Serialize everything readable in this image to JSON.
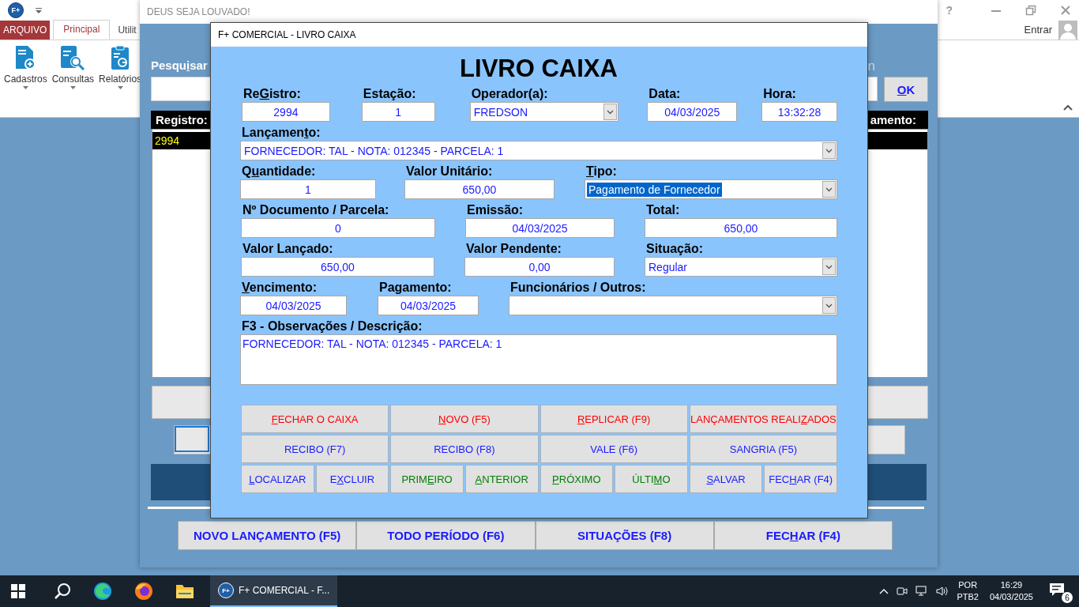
{
  "app": {
    "logo": "F+",
    "help": "?",
    "user": "Entrar",
    "tabs": [
      {
        "label": "ARQUIVO",
        "kind": "file",
        "selected": false
      },
      {
        "label": "Principal",
        "kind": "tab",
        "selected": true
      },
      {
        "label": "Utilit",
        "kind": "tab",
        "selected": false
      }
    ],
    "ribbon": [
      {
        "label": "Cadastros",
        "kind": "register"
      },
      {
        "label": "Consultas",
        "kind": "query"
      },
      {
        "label": "Relatórios",
        "kind": "report"
      }
    ]
  },
  "background_window": {
    "title": "DEUS SEJA LOUVADO!",
    "search_label": {
      "before": "Pesqu",
      "key": "i",
      "after": "sar"
    },
    "search_label_2": "n",
    "ok_button": {
      "key": "O",
      "after": "K"
    },
    "table": {
      "columns": [
        "Registro:",
        "amento:"
      ],
      "rows": [
        {
          "cells": [
            "2994"
          ],
          "selected": true
        }
      ]
    },
    "buttons": [
      {
        "label": "NOVO LANÇAMENTO (F5)"
      },
      {
        "label": "TODO PERÍODO (F6)"
      },
      {
        "label": "SITUAÇÕES (F8)"
      },
      {
        "label": {
          "before": "FEC",
          "key": "H",
          "after": "AR (F4)"
        }
      }
    ]
  },
  "dialog": {
    "title": "F+ COMERCIAL - LIVRO CAIXA",
    "heading": "LIVRO CAIXA",
    "rows": [
      [
        {
          "label": {
            "before": "Re",
            "key": "G",
            "after": "istro:"
          },
          "value": "2994",
          "kind": "input"
        },
        {
          "label": "Estação:",
          "value": "1",
          "kind": "input"
        },
        {
          "label": "Operador(a):",
          "value": "FREDSON",
          "kind": "combo"
        },
        {
          "label": "Data:",
          "value": "04/03/2025",
          "kind": "input"
        },
        {
          "label": "Hora:",
          "value": "13:32:28",
          "kind": "input"
        }
      ],
      [
        {
          "label": {
            "before": "Lançamen",
            "key": "t",
            "after": "o:"
          },
          "value": "FORNECEDOR: TAL - NOTA: 012345 - PARCELA: 1",
          "kind": "combo"
        }
      ],
      [
        {
          "label": {
            "before": "Q",
            "key": "u",
            "after": "antidade:"
          },
          "value": "1",
          "kind": "input"
        },
        {
          "label": "Valor Unitário:",
          "value": "650,00",
          "kind": "input"
        },
        {
          "label": {
            "key": "T",
            "after": "ipo:"
          },
          "value": "Pagamento de Fornecedor",
          "kind": "combo",
          "highlighted": true
        }
      ],
      [
        {
          "label": "Nº Documento / Parcela:",
          "value": "0",
          "kind": "input"
        },
        {
          "label": "Emissão:",
          "value": "04/03/2025",
          "kind": "input"
        },
        {
          "label": "Total:",
          "value": "650,00",
          "kind": "input"
        }
      ],
      [
        {
          "label": "Valor Lançado:",
          "value": "650,00",
          "kind": "input"
        },
        {
          "label": "Valor Pendente:",
          "value": "0,00",
          "kind": "input"
        },
        {
          "label": "Situação:",
          "value": "Regular",
          "kind": "combo"
        }
      ],
      [
        {
          "label": {
            "key": "V",
            "after": "encimento:"
          },
          "value": "04/03/2025",
          "kind": "input"
        },
        {
          "label": "Pagamento:",
          "value": "04/03/2025",
          "kind": "input"
        },
        {
          "label": "Funcionários / Outros:",
          "kind": "combo"
        }
      ]
    ],
    "notes": {
      "label": "F3 - Observações / Descrição:",
      "value": "FORNECEDOR: TAL - NOTA: 012345 - PARCELA: 1"
    },
    "buttons": [
      {
        "label": {
          "key": "F",
          "after": "ECHAR O CAIXA"
        },
        "color": "#ff0000"
      },
      {
        "label": {
          "key": "N",
          "after": "OVO (F5)"
        },
        "color": "#ff0000"
      },
      {
        "label": {
          "key": "R",
          "after": "EPLICAR (F9)"
        },
        "color": "#ff0000"
      },
      {
        "label": {
          "before": "LANÇAMENTOS REALI",
          "key": "Z",
          "after": "ADOS"
        },
        "color": "#ff0000"
      },
      {
        "label": "RECIBO (F7)",
        "color": "#1a1aff"
      },
      {
        "label": "RECIBO (F8)",
        "color": "#1a1aff"
      },
      {
        "label": "VALE (F6)",
        "color": "#1a1aff"
      },
      {
        "label": "SANGRIA (F5)",
        "color": "#1a1aff"
      },
      {
        "label": {
          "key": "L",
          "after": "OCALIZAR"
        },
        "color": "#1a1aff"
      },
      {
        "label": {
          "before": "E",
          "key": "X",
          "after": "CLUIR"
        },
        "color": "#1a1aff"
      },
      {
        "label": {
          "before": "PRIM",
          "key": "E",
          "after": "IRO"
        },
        "color": "#008000"
      },
      {
        "label": {
          "key": "A",
          "after": "NTERIOR"
        },
        "color": "#008000"
      },
      {
        "label": {
          "key": "P",
          "after": "RÓXIMO"
        },
        "color": "#008000"
      },
      {
        "label": {
          "before": "ÚLTI",
          "key": "M",
          "after": "O"
        },
        "color": "#008000"
      },
      {
        "label": {
          "key": "S",
          "after": "ALVAR"
        },
        "color": "#1a1aff"
      },
      {
        "label": {
          "before": "FEC",
          "key": "H",
          "after": "AR (F4)"
        },
        "color": "#1a1aff"
      }
    ]
  },
  "taskbar": {
    "app": {
      "icon_text": "F+",
      "label": "F+ COMERCIAL - F...",
      "active": true
    },
    "language": [
      "POR",
      "PTB2"
    ],
    "time": "16:29",
    "date": "04/03/2025",
    "notifications": "6"
  }
}
